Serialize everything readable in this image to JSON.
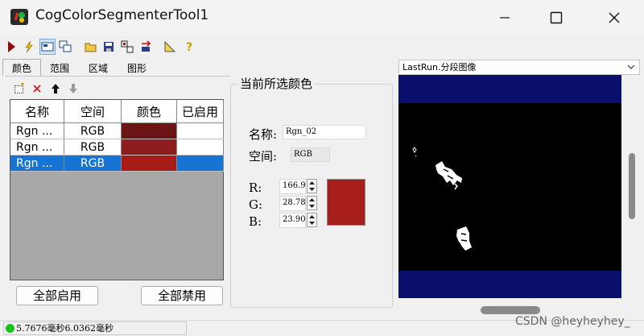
{
  "window": {
    "title": "CogColorSegmenterTool1"
  },
  "tabs": [
    "颜色",
    "范围",
    "区域",
    "图形"
  ],
  "color_table": {
    "columns": [
      "名称",
      "空间",
      "颜色",
      "已启用"
    ],
    "rows": [
      {
        "name": "Rgn ...",
        "space": "RGB",
        "color": "#6a1414",
        "selected": false
      },
      {
        "name": "Rgn ...",
        "space": "RGB",
        "color": "#8e1c1c",
        "selected": false
      },
      {
        "name": "Rgn ...",
        "space": "RGB",
        "color": "#a61c18",
        "selected": true
      }
    ]
  },
  "buttons": {
    "enable_all": "全部启用",
    "disable_all": "全部禁用"
  },
  "current_color": {
    "group_title": "当前所选颜色",
    "name_label": "名称:",
    "name_value": "Rgn_02",
    "space_label": "空间:",
    "space_value": "RGB",
    "r_label": "R:",
    "r_value": "166.9",
    "g_label": "G:",
    "g_value": "28.78",
    "b_label": "B:",
    "b_value": "23.90",
    "swatch_color": "#a71e1a"
  },
  "image_view": {
    "selected": "LastRun.分段图像"
  },
  "status": {
    "time_text": "5.7676毫秒6.0362毫秒"
  },
  "watermark": "CSDN @heyheyhey_",
  "colors": {
    "accent": "#1874d2",
    "view_bg": "#0a0f6e",
    "status_led": "#18c21a"
  }
}
